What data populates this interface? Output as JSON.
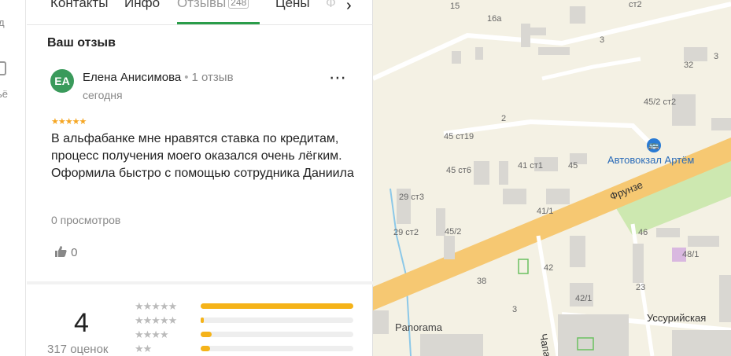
{
  "edge": {
    "item1": "д",
    "item2": "ьё"
  },
  "tabs": {
    "items": [
      {
        "label": "Контакты"
      },
      {
        "label": "Инфо"
      },
      {
        "label": "Отзывы",
        "count": "248",
        "active": true
      },
      {
        "label": "Цены"
      },
      {
        "label": "Ф"
      }
    ],
    "next_icon": "chevron-right-icon"
  },
  "review": {
    "section_title": "Ваш отзыв",
    "avatar_initials": "ЕА",
    "avatar_color": "#3a9a5b",
    "author": "Елена Анисимова",
    "author_reviews": "1 отзыв",
    "date": "сегодня",
    "stars": 5,
    "text": "В альфабанке мне нравятся ставка по кредитам, процесс получения моего оказался очень лёгким. Оформила быстро с помощью сотрудника Даниила",
    "views": "0 просмотров",
    "likes": "0"
  },
  "summary": {
    "rating": "4",
    "count": "317 оценок",
    "bars": [
      {
        "stars": 5,
        "fraction": 1.0
      },
      {
        "stars": 4,
        "fraction": 0.02
      },
      {
        "stars": 3,
        "fraction": 0.07
      },
      {
        "stars": 2,
        "fraction": 0.06
      }
    ]
  },
  "map": {
    "labels": {
      "l15": "15",
      "l16a": "16а",
      "l3a": "3",
      "l3b": "3",
      "l32": "32",
      "l2": "2",
      "l45ct2": "45/2 ст2",
      "l45ct19": "45 ст19",
      "l41ct1": "41 ст1",
      "l45": "45",
      "l45ct6": "45 ст6",
      "l29ct3": "29 ст3",
      "l29ct2": "29 ст2",
      "l452": "45/2",
      "l411": "41/1",
      "l46": "46",
      "l481": "48/1",
      "l38": "38",
      "l42": "42",
      "l421": "42/1",
      "l23": "23",
      "l3c": "3",
      "lct2": "ст2"
    },
    "bus_station": "Автовокзал Артём",
    "street_main": "Фрунзе",
    "street_2": "Уссурийская",
    "poi": "Panorama",
    "street_3": "Чапа"
  },
  "colors": {
    "accent_green": "#2a9d4a",
    "star": "#f5b319",
    "map_road": "#f6c872",
    "map_park": "#cde8b0"
  }
}
